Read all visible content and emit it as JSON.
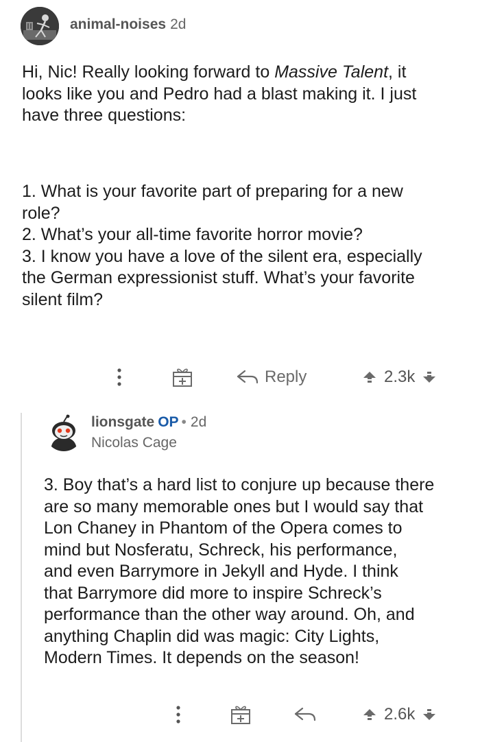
{
  "parent_comment": {
    "username": "animal-noises",
    "time": "2d",
    "avatar_icon": "skeleton-avatar-icon",
    "paragraph1_lines": [
      [
        "Hi, Nic! Really looking forward to ",
        "Massive Talent",
        ", it"
      ],
      "looks like you and Pedro had a blast making it. I just",
      "have three questions:"
    ],
    "paragraph2_lines": [
      "1. What is your favorite part of preparing for a new",
      "role?",
      "2. What’s your all-time favorite horror movie?",
      "3. I know you have a love of the silent era, especially",
      "the German expressionist stuff. What’s your favorite",
      "silent film?"
    ],
    "actions": {
      "more_icon": "more-vertical-icon",
      "award_icon": "gift-award-icon",
      "reply_icon": "reply-arrow-icon",
      "reply_label": "Reply",
      "upvote_icon": "upvote-arrow-icon",
      "score": "2.3k",
      "downvote_icon": "downvote-arrow-icon"
    }
  },
  "reply_comment": {
    "username": "lionsgate",
    "op_badge": "OP",
    "separator": "•",
    "time": "2d",
    "flair": "Nicolas Cage",
    "avatar_icon": "snoo-avatar-icon",
    "lines": [
      "3. Boy that’s a hard list to conjure up because there",
      "are so many memorable ones but I would say that",
      "Lon Chaney in Phantom of the Opera comes to",
      "mind but Nosferatu, Schreck, his performance,",
      "and even Barrymore in Jekyll and Hyde. I think",
      "that Barrymore did more to inspire Schreck’s",
      "performance than the other way around. Oh, and",
      "anything Chaplin did was magic: City Lights,",
      "Modern Times. It depends on the season!"
    ],
    "actions": {
      "more_icon": "more-vertical-icon",
      "award_icon": "gift-award-icon",
      "reply_icon": "reply-arrow-icon",
      "upvote_icon": "upvote-arrow-icon",
      "score": "2.6k",
      "downvote_icon": "downvote-arrow-icon"
    }
  },
  "colors": {
    "text": "#1c1c1c",
    "meta": "#666666",
    "op_blue": "#1a5ba8",
    "thread_line": "#dcdcdc"
  }
}
